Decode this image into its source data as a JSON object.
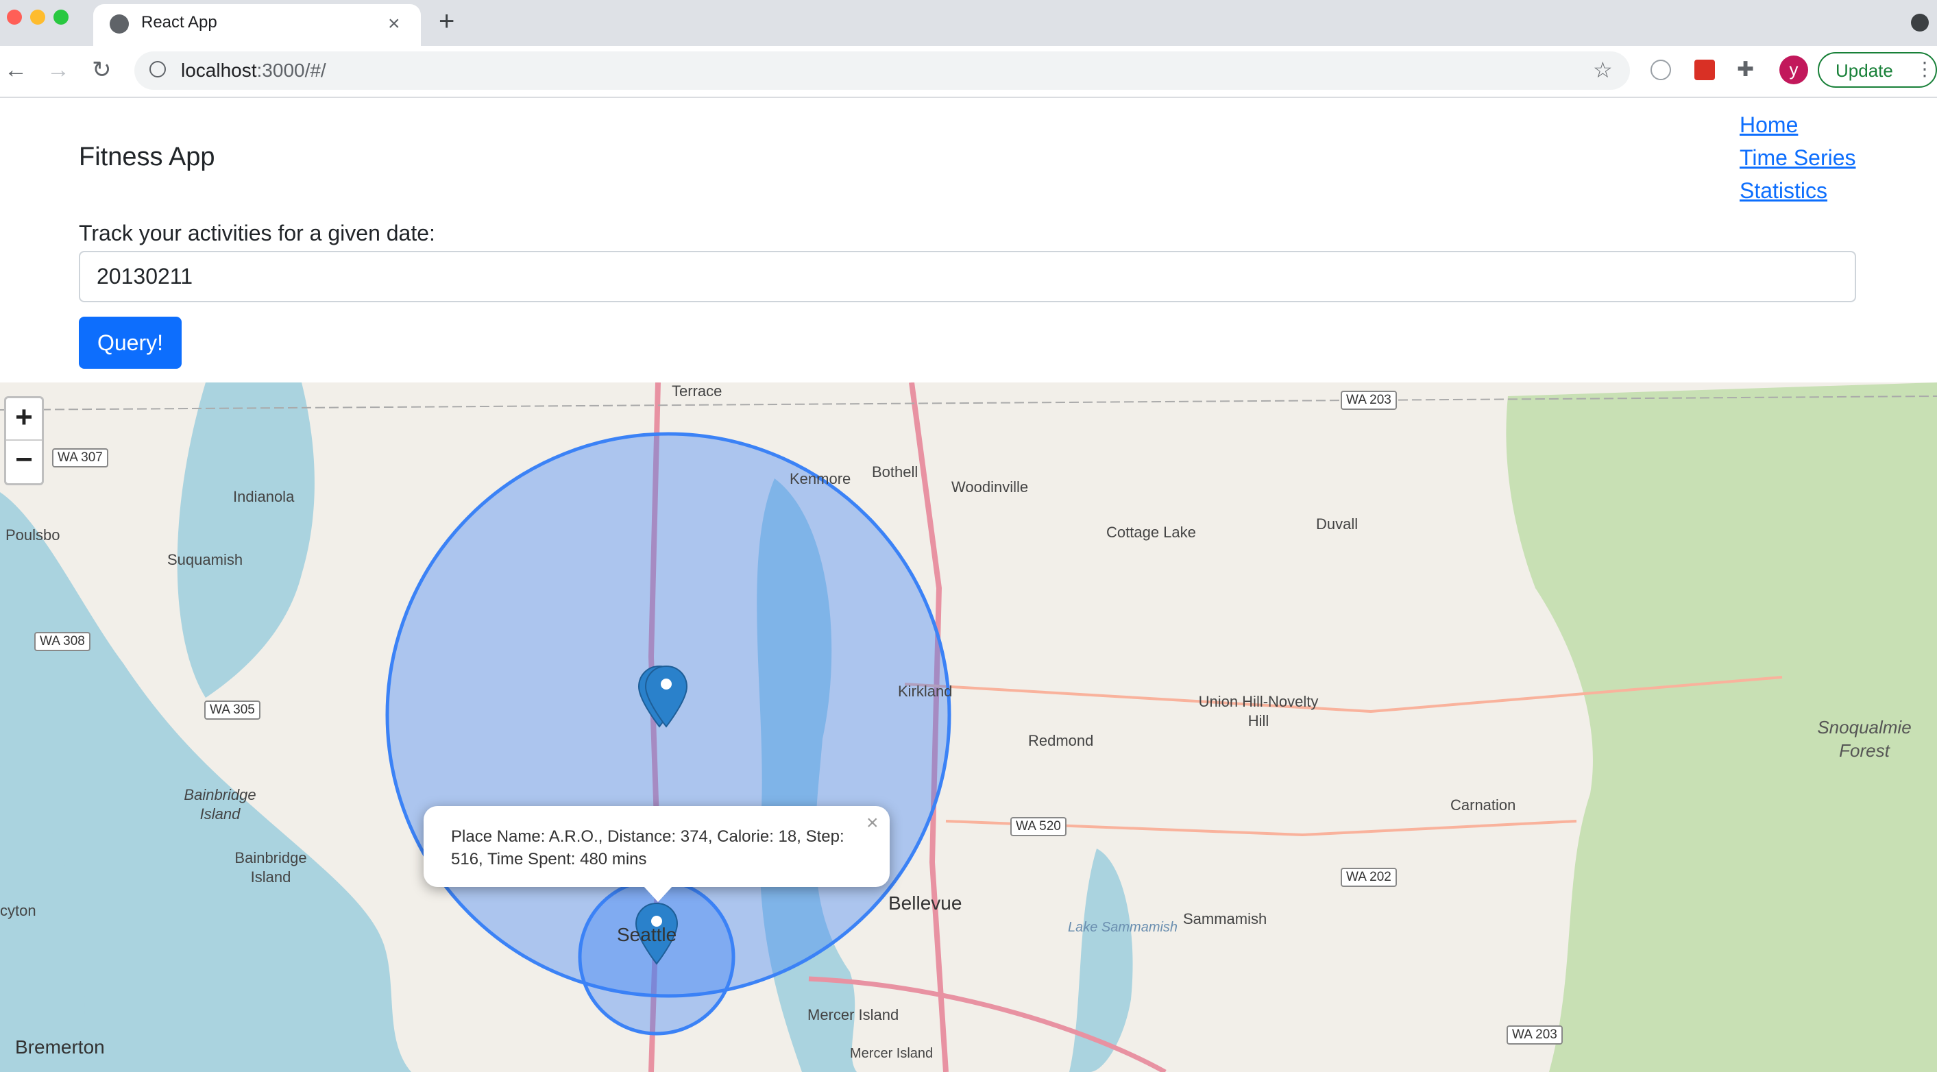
{
  "browser": {
    "tab_title": "React App",
    "new_tab_symbol": "+",
    "close_symbol": "×",
    "url_host": "localhost",
    "url_path": ":3000/#/",
    "profile_initial": "y",
    "update_label": "Update",
    "icons": [
      "globe-icon",
      "back-icon",
      "forward-icon",
      "reload-icon",
      "info-icon",
      "star-icon",
      "extension-icon",
      "puzzle-icon",
      "menu-icon"
    ]
  },
  "header": {
    "title": "Fitness App",
    "nav": [
      "Home",
      "Time Series",
      "Statistics"
    ]
  },
  "form": {
    "label": "Track your activities for a given date:",
    "date_value": "20130211",
    "button_label": "Query!"
  },
  "map": {
    "zoom_in": "+",
    "zoom_out": "−",
    "popup_text": "Place Name: A.R.O., Distance: 374, Calorie: 18, Step: 516, Time Spent: 480 mins",
    "popup_close": "×",
    "places": [
      "Terrace",
      "Kenmore",
      "Bothell",
      "Woodinville",
      "Indianola",
      "Poulsbo",
      "Suquamish",
      "Cottage Lake",
      "Duvall",
      "Kirkland",
      "Union Hill-Novelty Hill",
      "Redmond",
      "Bainbridge Island",
      "Bainbridge Island",
      "Carnation",
      "Bellevue",
      "Sammamish",
      "Seattle",
      "Mercer Island",
      "Bremerton",
      "Mercer Island",
      "cyton"
    ],
    "water_labels": [
      "Lake Sammamish"
    ],
    "regions": [
      "Snoqualmie Forest"
    ],
    "shields": [
      "WA 203",
      "WA 307",
      "WA 308",
      "WA 305",
      "WA 520",
      "WA 202",
      "WA 203"
    ],
    "circle_color": "#3b82f6",
    "marker_color": "#2a81cb"
  }
}
